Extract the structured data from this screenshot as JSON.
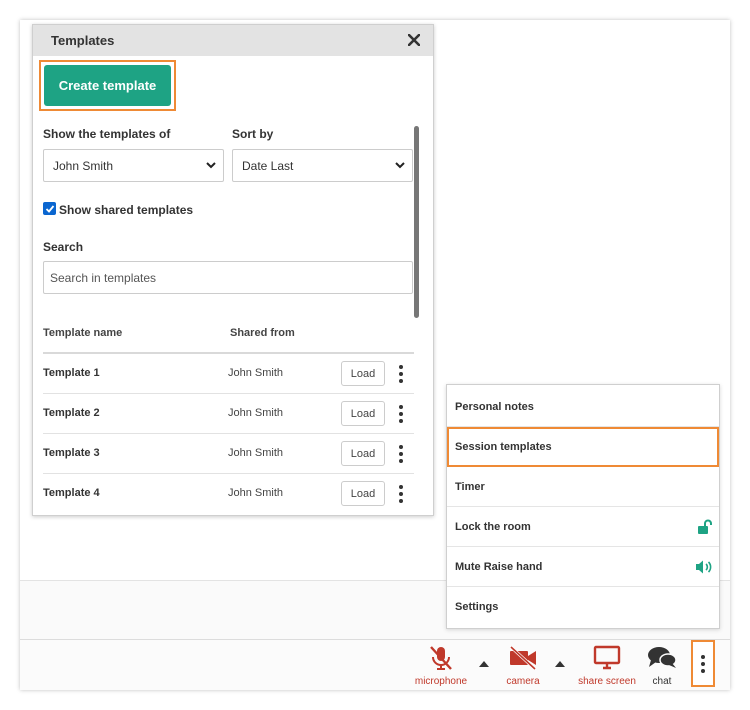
{
  "panel": {
    "title": "Templates",
    "create_button": "Create template",
    "show_templates_label": "Show the templates of",
    "show_templates_value": "John Smith",
    "sort_by_label": "Sort by",
    "sort_by_value": "Date Last",
    "shared_checkbox_label": "Show shared templates",
    "shared_checkbox_checked": true,
    "search_label": "Search",
    "search_placeholder": "Search in templates",
    "columns": {
      "name": "Template name",
      "shared_from": "Shared from"
    },
    "rows": [
      {
        "name": "Template 1",
        "shared_from": "John Smith",
        "action": "Load"
      },
      {
        "name": "Template 2",
        "shared_from": "John Smith",
        "action": "Load"
      },
      {
        "name": "Template 3",
        "shared_from": "John Smith",
        "action": "Load"
      },
      {
        "name": "Template 4",
        "shared_from": "John Smith",
        "action": "Load"
      }
    ]
  },
  "menu": {
    "items": [
      {
        "label": "Personal notes"
      },
      {
        "label": "Session templates",
        "active": true
      },
      {
        "label": "Timer"
      },
      {
        "label": "Lock the room",
        "icon": "unlocked-padlock-icon"
      },
      {
        "label": "Mute Raise hand",
        "icon": "speaker-volume-icon"
      },
      {
        "label": "Settings"
      }
    ]
  },
  "toolbar": {
    "microphone": "microphone",
    "camera": "camera",
    "share_screen": "share screen",
    "chat": "chat"
  },
  "colors": {
    "accent_orange": "#ef8a35",
    "primary_green": "#1ea384",
    "toolbar_red": "#c0392b",
    "checkbox_blue": "#0a66d0"
  }
}
